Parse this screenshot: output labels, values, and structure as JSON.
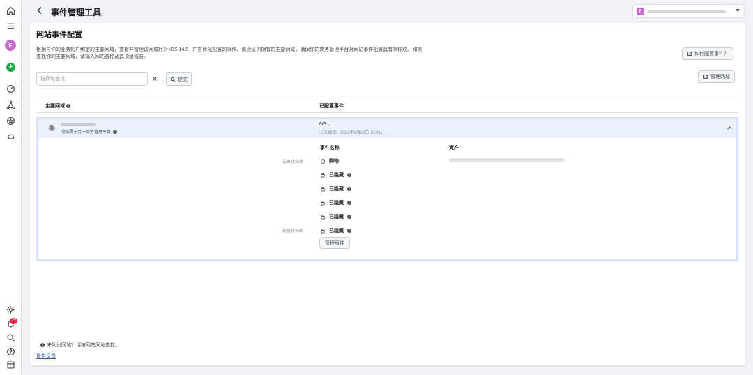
{
  "header": {
    "title": "事件管理工具",
    "account_initial": "F"
  },
  "sidebar": {
    "avatar_initial": "F",
    "notification_count": "25"
  },
  "page": {
    "title": "网站事件配置",
    "description": "根据与你的业务帐户绑定的主要网域，查看并管理该网域针对 iOS 14.5+ 广告优化配置的事件。请验证你拥有的主要网域，确保你的商务管理平台对网站事件配置具有掌控权。如需查找你的主要网域，请输入网站名称及其顶级域名。",
    "howto_label": "如何配置事件？",
    "manage_domains_label": "管理网域"
  },
  "search": {
    "placeholder": "按网址查找",
    "submit_label": "提交"
  },
  "table": {
    "col_domain": "主要网域",
    "col_events": "已配置事件"
  },
  "domain_row": {
    "note": "网域属于另一商务管理平台",
    "configured_count": "6/8",
    "last_edited": "上次编辑：2022年6月22日 10:41。",
    "sub_col_event_name": "事件名称",
    "sub_col_asset": "资产",
    "highest_priority": "最高优先级",
    "lowest_priority": "最低优先级",
    "events": [
      {
        "label": "购物",
        "icon": "shopping-bag-icon"
      },
      {
        "label": "已隐藏",
        "icon": "lock-icon"
      },
      {
        "label": "已隐藏",
        "icon": "lock-icon"
      },
      {
        "label": "已隐藏",
        "icon": "lock-icon"
      },
      {
        "label": "已隐藏",
        "icon": "lock-icon"
      },
      {
        "label": "已隐藏",
        "icon": "lock-icon"
      }
    ],
    "manage_events_label": "管理事件"
  },
  "footer": {
    "not_listed": "未列出网站？请按网站网址查找。",
    "feedback": "提供反馈"
  },
  "colors": {
    "accent_blue": "#385898",
    "avatar_purple": "#c66bc9",
    "add_green": "#1fa84a",
    "badge_red": "#e41e3f"
  }
}
